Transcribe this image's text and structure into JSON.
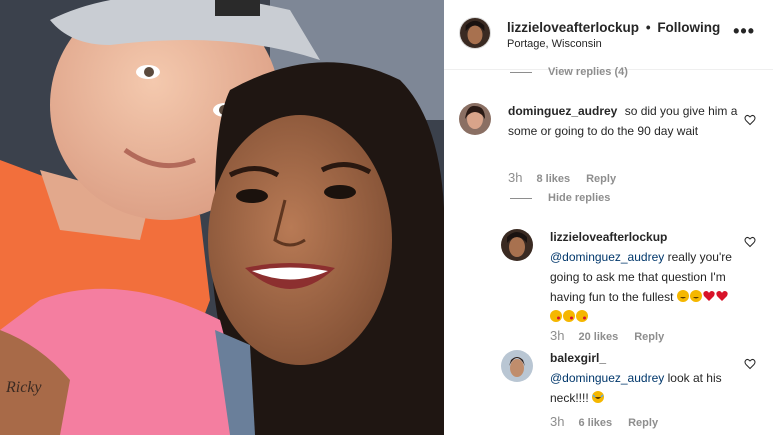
{
  "post": {
    "username": "lizzieloveafterlockup",
    "separator": "•",
    "follow_state": "Following",
    "location": "Portage, Wisconsin",
    "more_icon": "more-horizontal-icon"
  },
  "view_replies": {
    "label": "View replies (4)"
  },
  "comments": [
    {
      "username": "dominguez_audrey",
      "text": "so did you give him a some or going to do the 90 day wait",
      "time": "3h",
      "likes": "8 likes",
      "reply": "Reply",
      "hide_replies": "Hide replies"
    },
    {
      "username": "lizzieloveafterlockup",
      "mention": "@dominguez_audrey",
      "text": "really you're going to ask me that question I'm having fun to the fullest",
      "emojis": [
        "rofl-emoji",
        "rofl-emoji",
        "red-heart-emoji",
        "red-heart-emoji",
        "kissing-emoji",
        "kissing-emoji",
        "kissing-emoji"
      ],
      "time": "3h",
      "likes": "20 likes",
      "reply": "Reply"
    },
    {
      "username": "balexgirl_",
      "mention": "@dominguez_audrey",
      "text": "look at his neck!!!!",
      "emojis": [
        "laughing-emoji"
      ],
      "time": "3h",
      "likes": "6 likes",
      "reply": "Reply"
    }
  ],
  "colors": {
    "mention": "#00376b",
    "meta": "#8e8e8e",
    "heart": "#e0245e"
  }
}
